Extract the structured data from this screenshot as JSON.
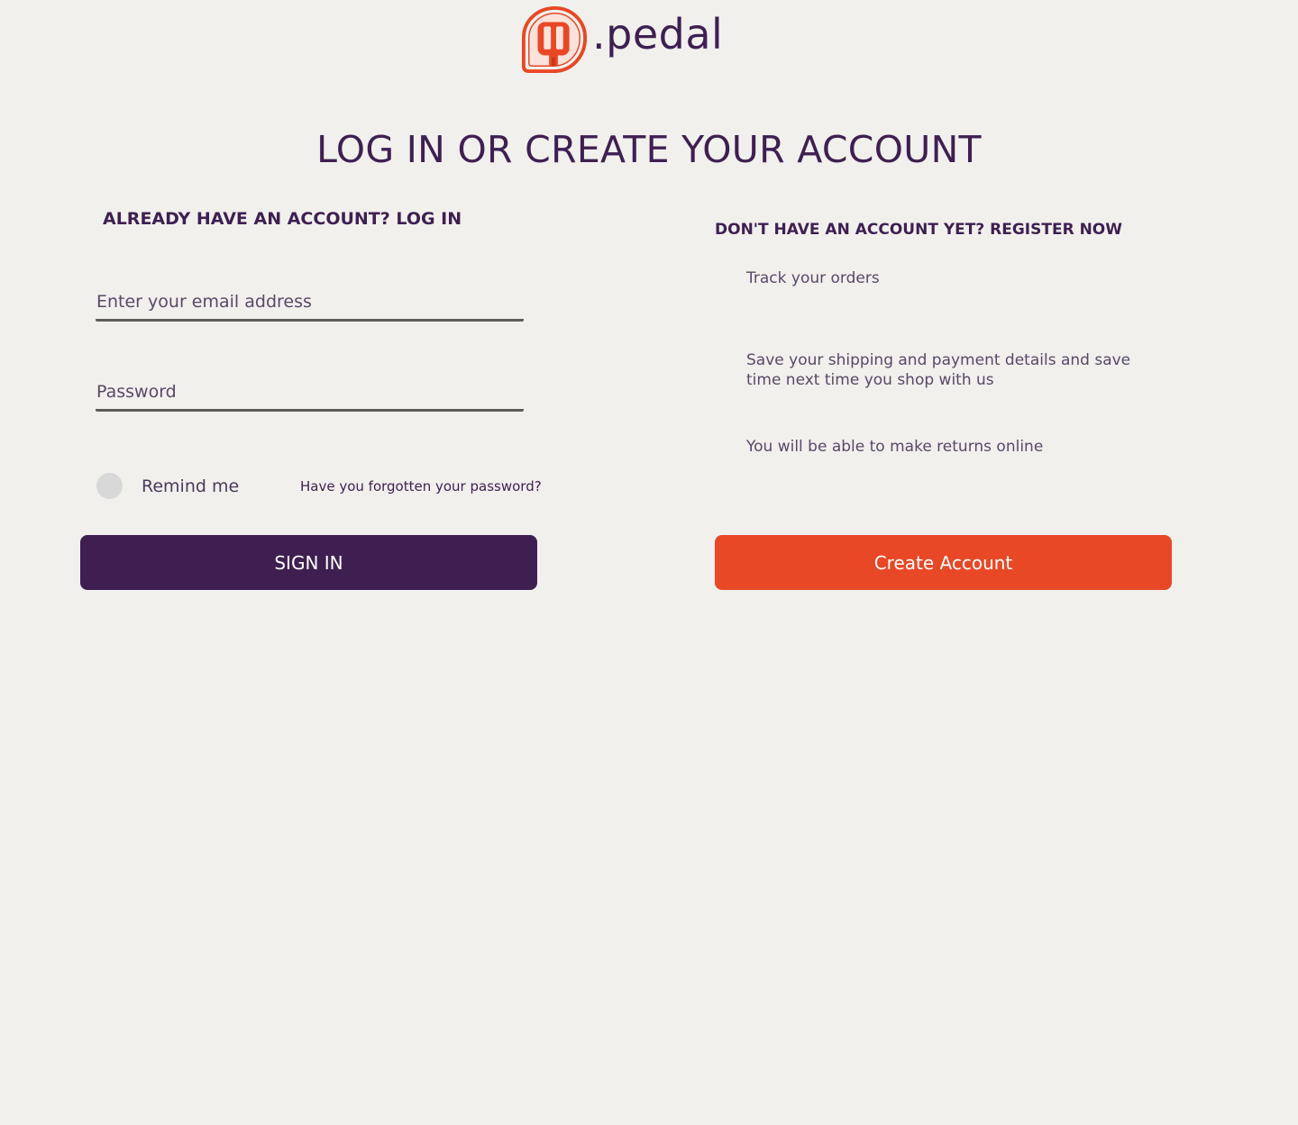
{
  "brand": {
    "name": ".pedal",
    "logo_icon": "pedal-logo-icon",
    "primary_color": "#3f1f52",
    "accent_color": "#e94826"
  },
  "page": {
    "title": "LOG IN OR CREATE YOUR ACCOUNT"
  },
  "login": {
    "heading": "ALREADY HAVE AN ACCOUNT? LOG IN",
    "email_placeholder": "Enter your email address",
    "email_value": "",
    "password_placeholder": "Password",
    "password_value": "",
    "remind_label": "Remind me",
    "remind_checked": false,
    "forgot_link": "Have you forgotten your password?",
    "submit_label": "SIGN IN"
  },
  "register": {
    "heading": "DON'T HAVE AN ACCOUNT YET? REGISTER NOW",
    "benefits": [
      "Track your orders",
      "Save your shipping and payment details and save time next time you shop with us",
      "You will be able to make returns online"
    ],
    "submit_label": "Create Account"
  }
}
